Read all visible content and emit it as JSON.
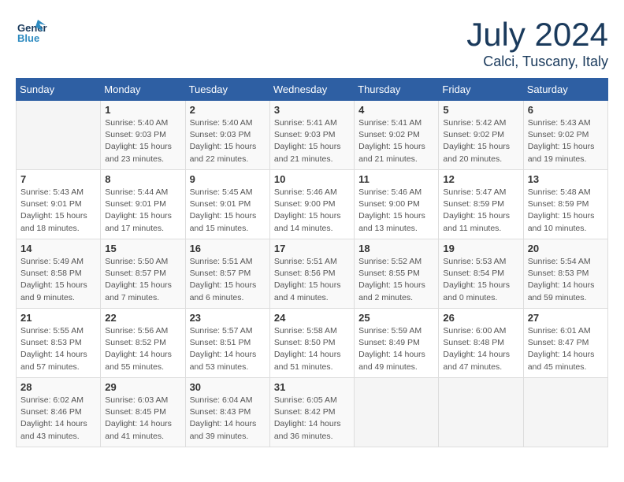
{
  "header": {
    "logo_general": "General",
    "logo_blue": "Blue",
    "month": "July 2024",
    "location": "Calci, Tuscany, Italy"
  },
  "weekdays": [
    "Sunday",
    "Monday",
    "Tuesday",
    "Wednesday",
    "Thursday",
    "Friday",
    "Saturday"
  ],
  "weeks": [
    [
      {
        "day": "",
        "detail": ""
      },
      {
        "day": "1",
        "detail": "Sunrise: 5:40 AM\nSunset: 9:03 PM\nDaylight: 15 hours\nand 23 minutes."
      },
      {
        "day": "2",
        "detail": "Sunrise: 5:40 AM\nSunset: 9:03 PM\nDaylight: 15 hours\nand 22 minutes."
      },
      {
        "day": "3",
        "detail": "Sunrise: 5:41 AM\nSunset: 9:03 PM\nDaylight: 15 hours\nand 21 minutes."
      },
      {
        "day": "4",
        "detail": "Sunrise: 5:41 AM\nSunset: 9:02 PM\nDaylight: 15 hours\nand 21 minutes."
      },
      {
        "day": "5",
        "detail": "Sunrise: 5:42 AM\nSunset: 9:02 PM\nDaylight: 15 hours\nand 20 minutes."
      },
      {
        "day": "6",
        "detail": "Sunrise: 5:43 AM\nSunset: 9:02 PM\nDaylight: 15 hours\nand 19 minutes."
      }
    ],
    [
      {
        "day": "7",
        "detail": "Sunrise: 5:43 AM\nSunset: 9:01 PM\nDaylight: 15 hours\nand 18 minutes."
      },
      {
        "day": "8",
        "detail": "Sunrise: 5:44 AM\nSunset: 9:01 PM\nDaylight: 15 hours\nand 17 minutes."
      },
      {
        "day": "9",
        "detail": "Sunrise: 5:45 AM\nSunset: 9:01 PM\nDaylight: 15 hours\nand 15 minutes."
      },
      {
        "day": "10",
        "detail": "Sunrise: 5:46 AM\nSunset: 9:00 PM\nDaylight: 15 hours\nand 14 minutes."
      },
      {
        "day": "11",
        "detail": "Sunrise: 5:46 AM\nSunset: 9:00 PM\nDaylight: 15 hours\nand 13 minutes."
      },
      {
        "day": "12",
        "detail": "Sunrise: 5:47 AM\nSunset: 8:59 PM\nDaylight: 15 hours\nand 11 minutes."
      },
      {
        "day": "13",
        "detail": "Sunrise: 5:48 AM\nSunset: 8:59 PM\nDaylight: 15 hours\nand 10 minutes."
      }
    ],
    [
      {
        "day": "14",
        "detail": "Sunrise: 5:49 AM\nSunset: 8:58 PM\nDaylight: 15 hours\nand 9 minutes."
      },
      {
        "day": "15",
        "detail": "Sunrise: 5:50 AM\nSunset: 8:57 PM\nDaylight: 15 hours\nand 7 minutes."
      },
      {
        "day": "16",
        "detail": "Sunrise: 5:51 AM\nSunset: 8:57 PM\nDaylight: 15 hours\nand 6 minutes."
      },
      {
        "day": "17",
        "detail": "Sunrise: 5:51 AM\nSunset: 8:56 PM\nDaylight: 15 hours\nand 4 minutes."
      },
      {
        "day": "18",
        "detail": "Sunrise: 5:52 AM\nSunset: 8:55 PM\nDaylight: 15 hours\nand 2 minutes."
      },
      {
        "day": "19",
        "detail": "Sunrise: 5:53 AM\nSunset: 8:54 PM\nDaylight: 15 hours\nand 0 minutes."
      },
      {
        "day": "20",
        "detail": "Sunrise: 5:54 AM\nSunset: 8:53 PM\nDaylight: 14 hours\nand 59 minutes."
      }
    ],
    [
      {
        "day": "21",
        "detail": "Sunrise: 5:55 AM\nSunset: 8:53 PM\nDaylight: 14 hours\nand 57 minutes."
      },
      {
        "day": "22",
        "detail": "Sunrise: 5:56 AM\nSunset: 8:52 PM\nDaylight: 14 hours\nand 55 minutes."
      },
      {
        "day": "23",
        "detail": "Sunrise: 5:57 AM\nSunset: 8:51 PM\nDaylight: 14 hours\nand 53 minutes."
      },
      {
        "day": "24",
        "detail": "Sunrise: 5:58 AM\nSunset: 8:50 PM\nDaylight: 14 hours\nand 51 minutes."
      },
      {
        "day": "25",
        "detail": "Sunrise: 5:59 AM\nSunset: 8:49 PM\nDaylight: 14 hours\nand 49 minutes."
      },
      {
        "day": "26",
        "detail": "Sunrise: 6:00 AM\nSunset: 8:48 PM\nDaylight: 14 hours\nand 47 minutes."
      },
      {
        "day": "27",
        "detail": "Sunrise: 6:01 AM\nSunset: 8:47 PM\nDaylight: 14 hours\nand 45 minutes."
      }
    ],
    [
      {
        "day": "28",
        "detail": "Sunrise: 6:02 AM\nSunset: 8:46 PM\nDaylight: 14 hours\nand 43 minutes."
      },
      {
        "day": "29",
        "detail": "Sunrise: 6:03 AM\nSunset: 8:45 PM\nDaylight: 14 hours\nand 41 minutes."
      },
      {
        "day": "30",
        "detail": "Sunrise: 6:04 AM\nSunset: 8:43 PM\nDaylight: 14 hours\nand 39 minutes."
      },
      {
        "day": "31",
        "detail": "Sunrise: 6:05 AM\nSunset: 8:42 PM\nDaylight: 14 hours\nand 36 minutes."
      },
      {
        "day": "",
        "detail": ""
      },
      {
        "day": "",
        "detail": ""
      },
      {
        "day": "",
        "detail": ""
      }
    ]
  ]
}
